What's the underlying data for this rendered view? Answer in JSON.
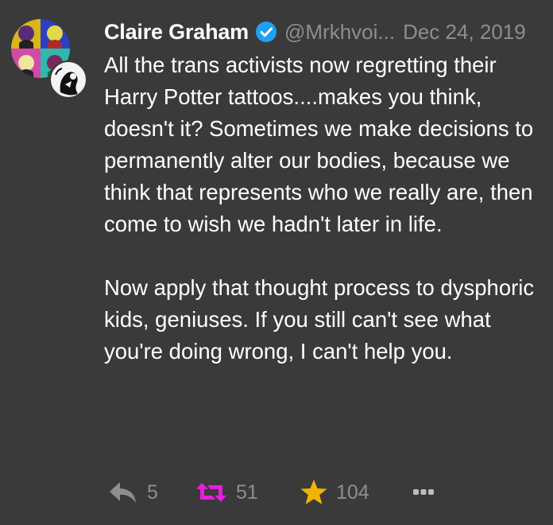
{
  "tweet": {
    "author_name": "Claire Graham",
    "handle": "@Mrkhvoi...",
    "date": "Dec 24, 2019",
    "paragraphs": [
      "All the trans activists now regretting their Harry Potter tattoos....makes you think, doesn't it? Sometimes we make decisions to permanently alter our bodies, because we think that represents who we really are, then come to wish we hadn't later in life.",
      "Now apply that thought process to dysphoric kids, geniuses. If you still can't see what you're doing wrong, I can't help you."
    ]
  },
  "actions": {
    "reply_count": "5",
    "retweet_count": "51",
    "like_count": "104"
  },
  "colors": {
    "background": "#3a3a3a",
    "text": "#ffffff",
    "muted": "#8e8e8e",
    "verified": "#1da1f2",
    "retweet_active": "#e81cde",
    "like_active": "#f0b400"
  },
  "icons": {
    "reply": "reply-icon",
    "retweet": "retweet-icon",
    "like": "star-icon",
    "more": "more-icon",
    "verified": "verified-badge-icon"
  }
}
